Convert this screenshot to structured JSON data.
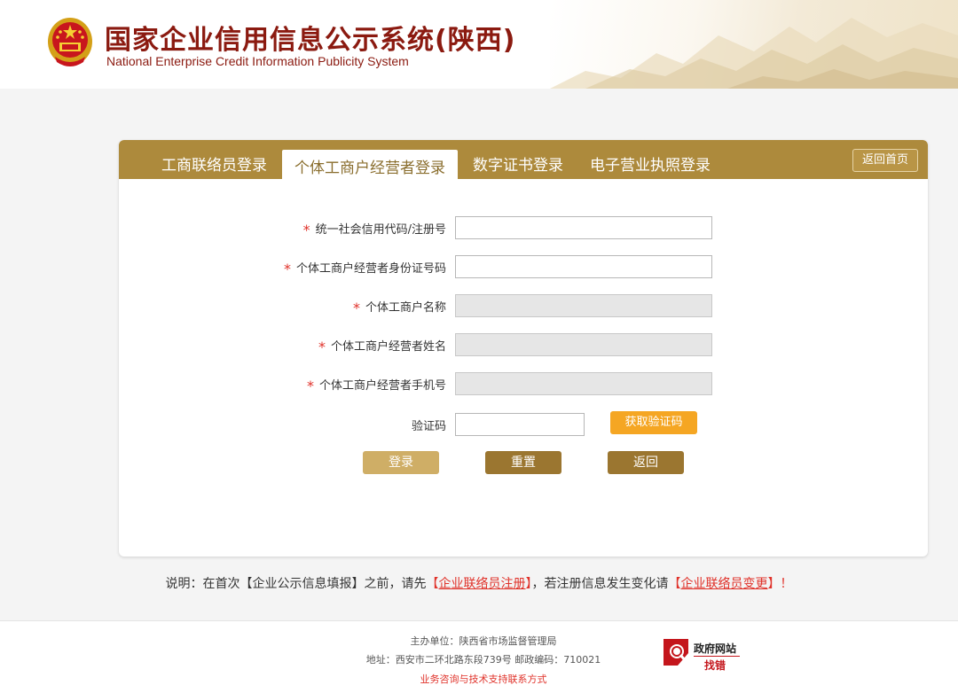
{
  "header": {
    "title": "国家企业信用信息公示系统(陕西)",
    "subtitle": "National Enterprise Credit Information Publicity System"
  },
  "tabs": [
    {
      "label": "工商联络员登录",
      "active": false
    },
    {
      "label": "个体工商户经营者登录",
      "active": true
    },
    {
      "label": "数字证书登录",
      "active": false
    },
    {
      "label": "电子营业执照登录",
      "active": false
    }
  ],
  "home_button": "返回首页",
  "form": {
    "fields": [
      {
        "label": "统一社会信用代码/注册号",
        "required": true,
        "readonly": false,
        "value": ""
      },
      {
        "label": "个体工商户经营者身份证号码",
        "required": true,
        "readonly": false,
        "value": ""
      },
      {
        "label": "个体工商户名称",
        "required": true,
        "readonly": true,
        "value": ""
      },
      {
        "label": "个体工商户经营者姓名",
        "required": true,
        "readonly": true,
        "value": ""
      },
      {
        "label": "个体工商户经营者手机号",
        "required": true,
        "readonly": true,
        "value": ""
      }
    ],
    "required_mark": "*",
    "captcha_label": "验证码",
    "captcha_value": "",
    "get_code_button": "获取验证码",
    "login_button": "登录",
    "reset_button": "重置",
    "back_button": "返回"
  },
  "note": {
    "prefix": "说明：在首次【企业公示信息填报】之前，请先",
    "link1_open": "【",
    "link1": "企业联络员注册",
    "link1_close": "】",
    "middle": "，若注册信息发生变化请",
    "link2_open": "【",
    "link2": "企业联络员变更",
    "link2_close": "】！"
  },
  "footer": {
    "sponsor": "主办单位：陕西省市场监督管理局",
    "address": "地址：西安市二环北路东段739号    邮政编码：710021",
    "contact": "业务咨询与技术支持联系方式",
    "gov_badge_line1": "政府网站",
    "gov_badge_line2": "找错"
  },
  "colors": {
    "brand_red": "#8b1a10",
    "tab_bar": "#ad8a3c",
    "alert_red": "#e0322a",
    "code_button": "#f5a623",
    "action_button": "#9b7630",
    "login_button": "#cfae66"
  }
}
